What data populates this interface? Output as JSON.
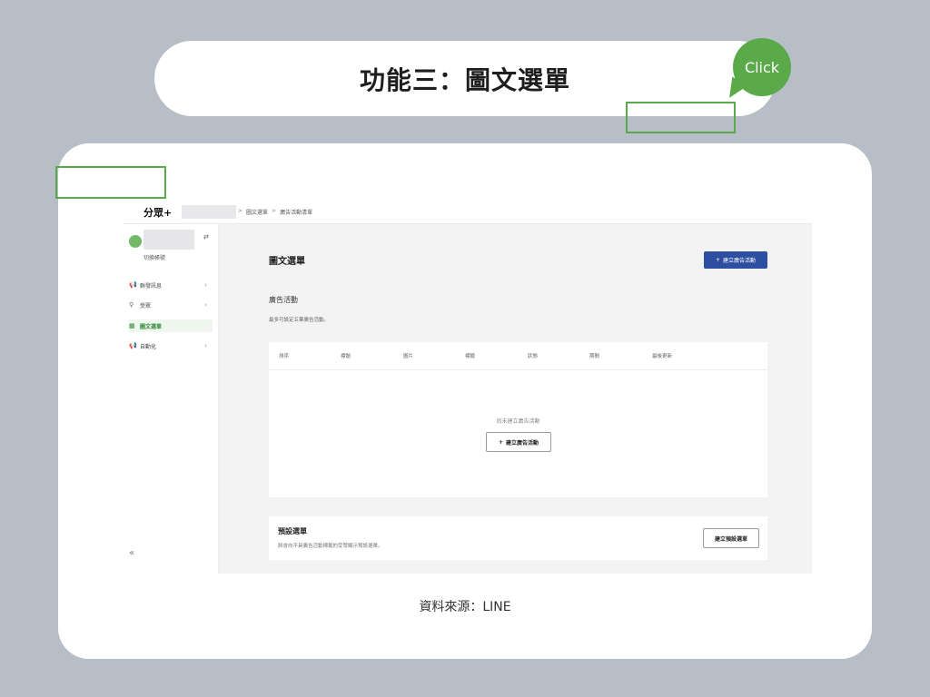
{
  "slide": {
    "title": "功能三：圖文選單",
    "source": "資料來源：LINE",
    "callout": "Click"
  },
  "app": {
    "brand": "分眾+",
    "breadcrumb": [
      "圖文選單",
      "廣告活動清單"
    ],
    "breadcrumb_sep": ">",
    "switch_account": "切換帳號",
    "sidebar": [
      {
        "icon": "megaphone-icon",
        "glyph": "📢",
        "label": "群發訊息",
        "active": false
      },
      {
        "icon": "location-pin-icon",
        "glyph": "⚲",
        "label": "受眾",
        "active": false
      },
      {
        "icon": "grid-menu-icon",
        "glyph": "▦",
        "label": "圖文選單",
        "active": true
      },
      {
        "icon": "megaphone-icon",
        "glyph": "📢",
        "label": "自動化",
        "active": false
      }
    ],
    "collapse": "«"
  },
  "main": {
    "title": "圖文選單",
    "create_button": "建立廣告活動",
    "section_title": "廣告活動",
    "section_desc": "最多可設定五筆廣告活動。",
    "columns": [
      "排序",
      "標題",
      "圖片",
      "標籤",
      "狀態",
      "期間",
      "最後更新"
    ],
    "empty_text": "尚未建立廣告活動",
    "empty_button": "建立廣告活動",
    "default_title": "預設選單",
    "default_desc": "將會向不具廣告活動標籤的受眾顯示預設選單。",
    "default_button": "建立預設選單"
  },
  "colors": {
    "background": "#b8bec7",
    "accent_green": "#5aaa4a",
    "primary_blue": "#2e4ea1"
  }
}
